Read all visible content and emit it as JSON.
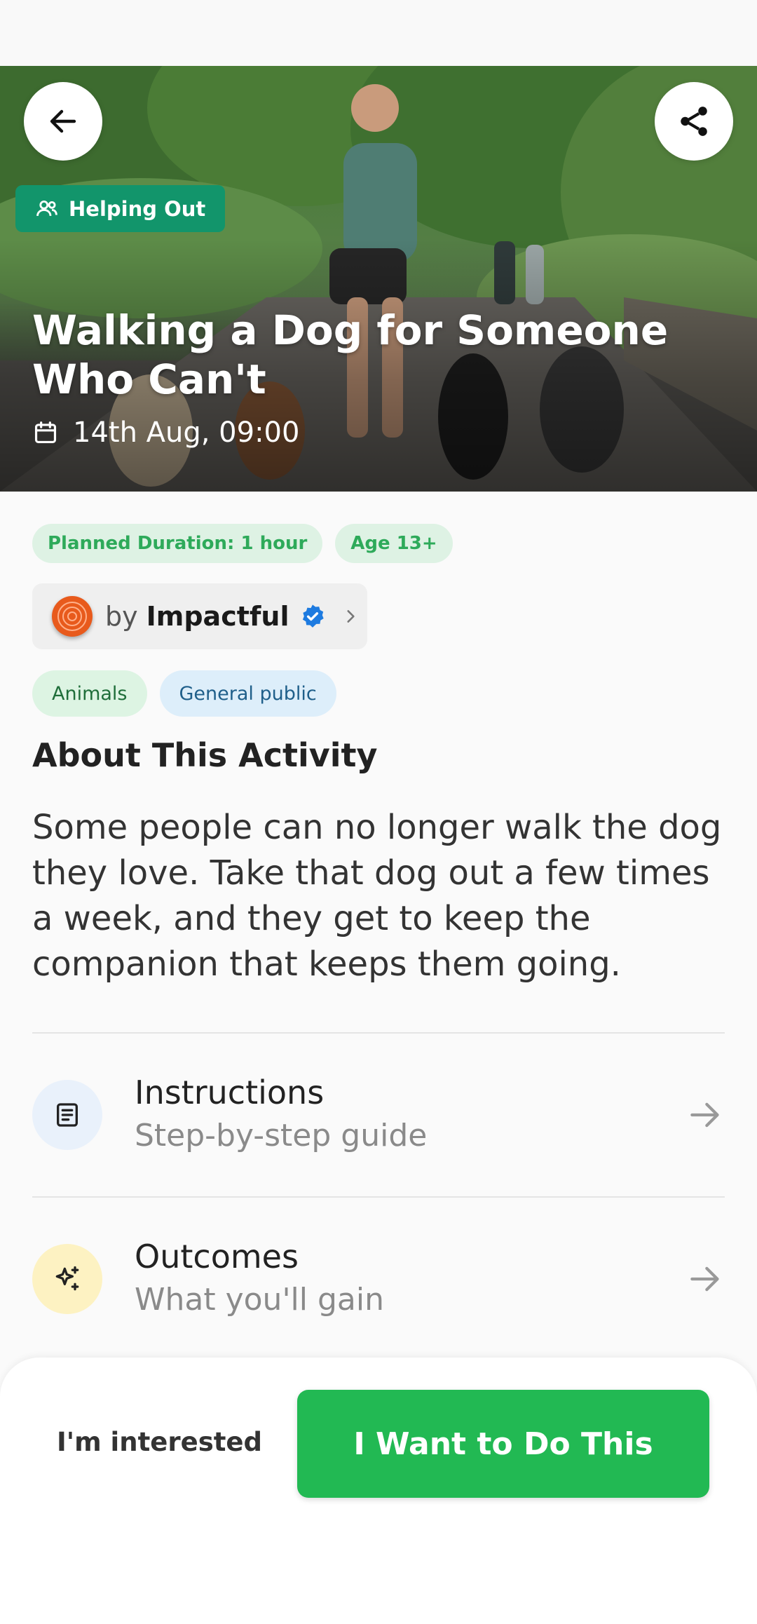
{
  "hero": {
    "category": "Helping Out",
    "title": "Walking a Dog for Someone Who Can't",
    "date": "14th Aug, 09:00"
  },
  "pills": [
    "Planned Duration: 1 hour",
    "Age 13+"
  ],
  "organizer": {
    "prefix": "by",
    "name": "Impactful"
  },
  "tags": [
    "Animals",
    "General public"
  ],
  "about": {
    "title": "About This Activity",
    "text": "Some people can no longer walk the dog they love. Take that dog out a few times a week, and they get to keep the companion that keeps them going."
  },
  "rows": [
    {
      "title": "Instructions",
      "subtitle": "Step-by-step guide",
      "icon": "document-icon"
    },
    {
      "title": "Outcomes",
      "subtitle": "What you'll gain",
      "icon": "sparkles-icon"
    }
  ],
  "actions": {
    "secondary": "I'm interested",
    "primary": "I Want to Do This"
  },
  "colors": {
    "accent": "#22b953",
    "badge": "#12956b",
    "verified": "#1e7be0",
    "org_logo": "#e85a1c"
  }
}
